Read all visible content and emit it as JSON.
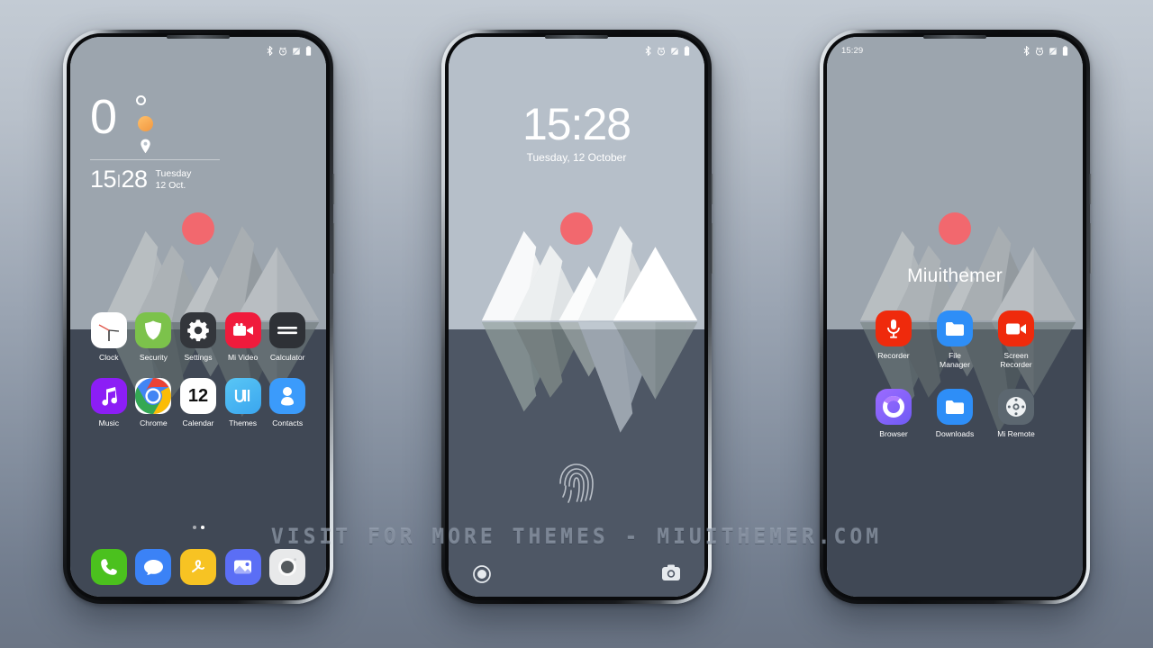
{
  "watermark": "VISIT  FOR  MORE  THEMES  -  MIUITHEMER.COM",
  "colors": {
    "sky": "#b9c2cb",
    "sea": "#464e5c",
    "sun": "#f2686e",
    "accent_orange": "#f2973f",
    "page_bg_top": "#c3cbd4",
    "page_bg_bottom": "#6b7585"
  },
  "phone1": {
    "statusbar": {
      "time": "",
      "icons": [
        "bluetooth-icon",
        "alarm-icon",
        "no-signal-icon",
        "battery-icon"
      ]
    },
    "weather_widget": {
      "temperature": "0",
      "degree_symbol": "°",
      "time": "15",
      "time_sep": "|",
      "time_minutes": "28",
      "weekday": "Tuesday",
      "date": "12 Oct."
    },
    "apps_row1": [
      {
        "label": "Clock",
        "icon": "clock-icon"
      },
      {
        "label": "Security",
        "icon": "shield-icon"
      },
      {
        "label": "Settings",
        "icon": "gear-icon"
      },
      {
        "label": "Mi Video",
        "icon": "video-camera-icon"
      },
      {
        "label": "Calculator",
        "icon": "calculator-icon"
      }
    ],
    "apps_row2": [
      {
        "label": "Music",
        "icon": "music-note-icon"
      },
      {
        "label": "Chrome",
        "icon": "chrome-icon"
      },
      {
        "label": "Calendar",
        "icon": "calendar-icon",
        "day": "12"
      },
      {
        "label": "Themes",
        "icon": "themes-icon"
      },
      {
        "label": "Contacts",
        "icon": "person-icon"
      }
    ],
    "dock": [
      {
        "label": "Phone",
        "icon": "phone-handset-icon"
      },
      {
        "label": "Messages",
        "icon": "chat-bubble-icon"
      },
      {
        "label": "Notes",
        "icon": "scribble-icon"
      },
      {
        "label": "Gallery",
        "icon": "photo-icon"
      },
      {
        "label": "Camera",
        "icon": "camera-lens-icon"
      }
    ],
    "page_dots": 2,
    "active_dot": 1
  },
  "phone2": {
    "statusbar": {
      "time": "",
      "icons": [
        "bluetooth-icon",
        "alarm-icon",
        "no-signal-icon",
        "battery-icon"
      ]
    },
    "lockscreen": {
      "time": "15:28",
      "date": "Tuesday, 12 October",
      "fingerprint": "fingerprint-icon",
      "shortcut_left": "flashlight-icon",
      "shortcut_right": "camera-icon"
    }
  },
  "phone3": {
    "statusbar": {
      "time": "15:29",
      "icons": [
        "bluetooth-icon",
        "alarm-icon",
        "no-signal-icon",
        "battery-icon"
      ]
    },
    "folder": {
      "title": "Miuithemer",
      "apps": [
        {
          "label": "Recorder",
          "icon": "microphone-icon"
        },
        {
          "label": "File\nManager",
          "icon": "folder-icon"
        },
        {
          "label": "Screen\nRecorder",
          "icon": "video-camera-icon"
        },
        {
          "label": "Browser",
          "icon": "browser-ring-icon"
        },
        {
          "label": "Downloads",
          "icon": "folder-icon"
        },
        {
          "label": "Mi Remote",
          "icon": "remote-control-icon"
        }
      ]
    }
  }
}
